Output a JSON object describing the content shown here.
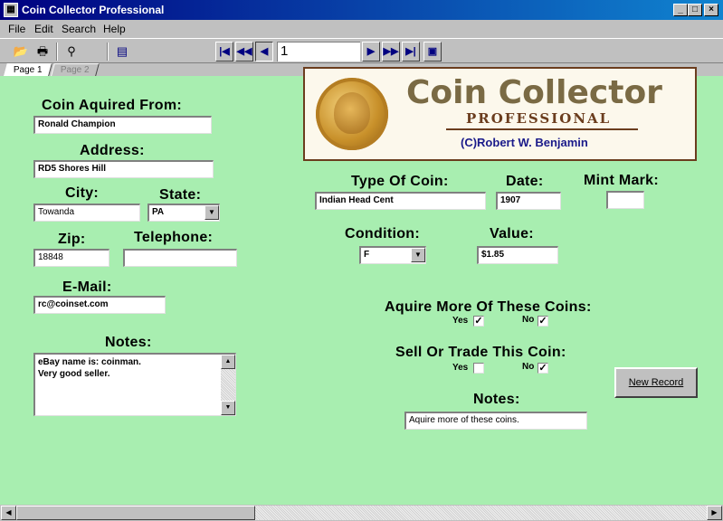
{
  "window": {
    "title": "Coin Collector Professional"
  },
  "menu": [
    "File",
    "Edit",
    "Search",
    "Help"
  ],
  "toolbar": {
    "record_number": "1"
  },
  "tabs": [
    "Page 1",
    "Page 2"
  ],
  "logo": {
    "title": "Coin Collector",
    "subtitle": "PROFESSIONAL",
    "copyright": "(C)Robert W. Benjamin"
  },
  "form": {
    "acquired_from_label": "Coin Aquired From:",
    "acquired_from_value": "Ronald Champion",
    "address_label": "Address:",
    "address_value": "RD5 Shores Hill",
    "city_label": "City:",
    "city_value": "Towanda",
    "state_label": "State:",
    "state_value": "PA",
    "zip_label": "Zip:",
    "zip_value": "18848",
    "telephone_label": "Telephone:",
    "telephone_value": "",
    "email_label": "E-Mail:",
    "email_value": "rc@coinset.com",
    "notes_left_label": "Notes:",
    "notes_left_line1": "eBay name is: coinman.",
    "notes_left_line2": "Very good seller.",
    "type_label": "Type Of Coin:",
    "type_value": "Indian Head Cent",
    "date_label": "Date:",
    "date_value": "1907",
    "mint_label": "Mint Mark:",
    "mint_value": "",
    "condition_label": "Condition:",
    "condition_value": "F",
    "value_label": "Value:",
    "value_value": "$1.85",
    "acquire_label": "Aquire More Of These Coins:",
    "sell_label": "Sell Or Trade This Coin:",
    "yes_label": "Yes",
    "no_label": "No",
    "acquire_yes": true,
    "acquire_no": true,
    "sell_yes": false,
    "sell_no": true,
    "notes_right_label": "Notes:",
    "notes_right_value": "Aquire more of these coins.",
    "new_record_button": "New Record"
  }
}
